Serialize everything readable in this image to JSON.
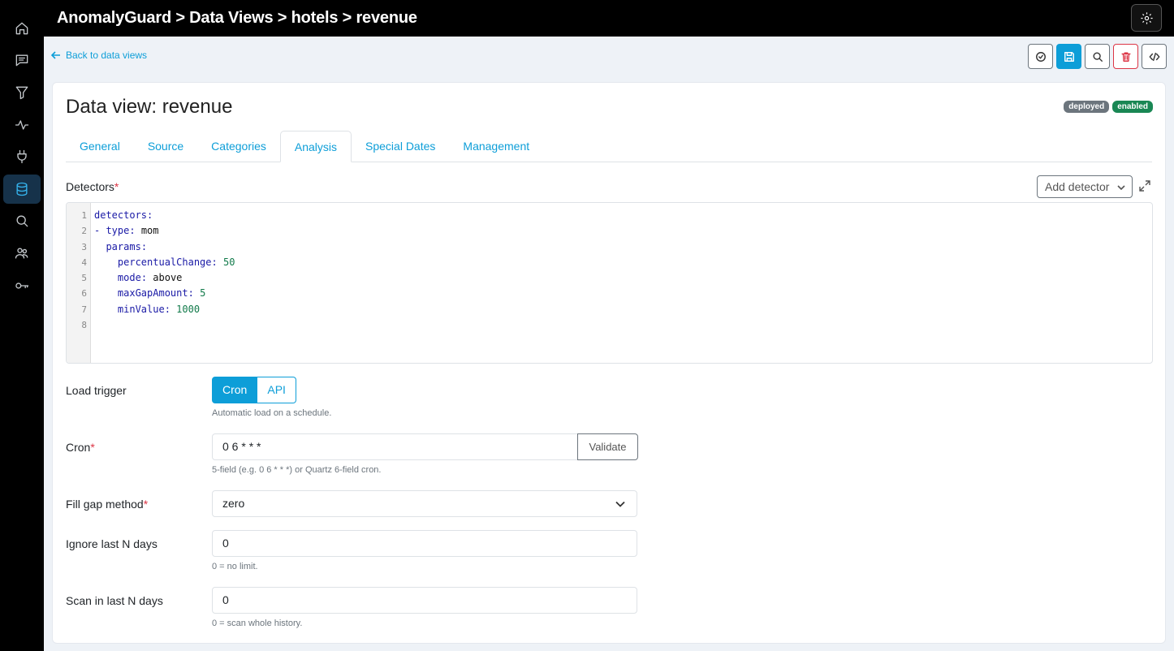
{
  "header": {
    "title": "AnomalyGuard > Data Views > hotels > revenue"
  },
  "sidebar": {
    "items": [
      {
        "icon": "home-icon"
      },
      {
        "icon": "chat-icon"
      },
      {
        "icon": "filter-icon"
      },
      {
        "icon": "activity-icon"
      },
      {
        "icon": "plug-icon"
      },
      {
        "icon": "database-icon",
        "active": true
      },
      {
        "icon": "search-icon"
      },
      {
        "icon": "users-icon"
      },
      {
        "icon": "key-icon"
      }
    ]
  },
  "nav": {
    "back_label": "Back to data views"
  },
  "toolbar": {
    "icons": [
      "check-circle-icon",
      "save-icon",
      "search-icon",
      "trash-icon",
      "code-icon"
    ]
  },
  "page": {
    "title": "Data view: revenue",
    "badges": [
      {
        "label": "deployed",
        "color": "#6c757d"
      },
      {
        "label": "enabled",
        "color": "#198754"
      }
    ]
  },
  "tabs": [
    "General",
    "Source",
    "Categories",
    "Analysis",
    "Special Dates",
    "Management"
  ],
  "active_tab": "Analysis",
  "detectors": {
    "label": "Detectors",
    "required_mark": "*",
    "add_button": "Add detector",
    "line_numbers": [
      "1",
      "2",
      "3",
      "4",
      "5",
      "6",
      "7",
      "8"
    ],
    "code": {
      "l1": "detectors:",
      "l2_dash": "- ",
      "l2_key": "type",
      "l2_val": "mom",
      "l3_key": "params",
      "l4_key": "percentualChange",
      "l4_val": "50",
      "l5_key": "mode",
      "l5_val": "above",
      "l6_key": "maxGapAmount",
      "l6_val": "5",
      "l7_key": "minValue",
      "l7_val": "1000",
      "colon": ":"
    }
  },
  "load_trigger": {
    "label": "Load trigger",
    "options": [
      "Cron",
      "API"
    ],
    "selected": "Cron",
    "help": "Automatic load on a schedule."
  },
  "cron": {
    "label": "Cron",
    "required_mark": "*",
    "value": "0 6 * * *",
    "validate_label": "Validate",
    "help": "5-field (e.g. 0 6 * * *) or Quartz 6-field cron."
  },
  "fill_gap": {
    "label": "Fill gap method",
    "required_mark": "*",
    "value": "zero"
  },
  "ignore_last": {
    "label": "Ignore last N days",
    "value": "0",
    "help": "0 = no limit."
  },
  "scan_last": {
    "label": "Scan in last N days",
    "value": "0",
    "help": "0 = scan whole history."
  },
  "colors": {
    "accent": "#0d9ed8",
    "danger": "#dc3545",
    "success": "#198754",
    "secondary": "#6c757d"
  }
}
